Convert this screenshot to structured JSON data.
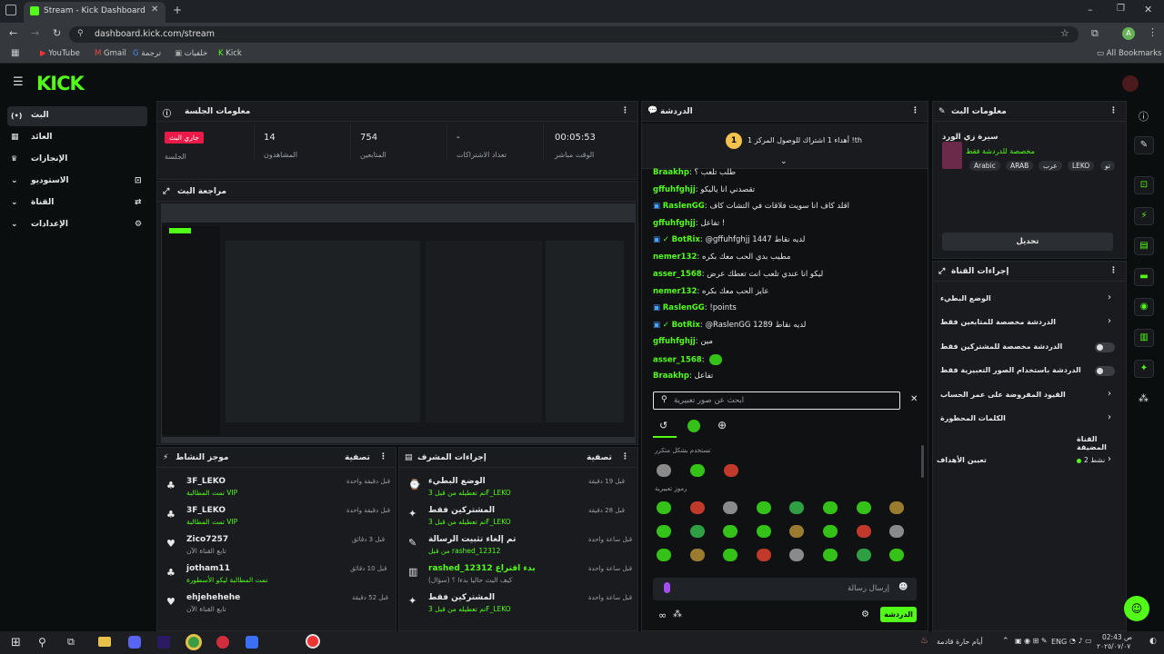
{
  "browser": {
    "tab_title": "Stream - Kick Dashboard",
    "url": "dashboard.kick.com/stream",
    "profile_initial": "A",
    "bookmarks": [
      "YouTube",
      "Gmail",
      "ترجمة",
      "خلفيات",
      "Kick"
    ],
    "all_bookmarks": "All Bookmarks"
  },
  "nav": {
    "items": [
      {
        "label": "البث",
        "icon": "(•)"
      },
      {
        "label": "العائد",
        "icon": "▦"
      },
      {
        "label": "الإنجازات",
        "icon": "🏆"
      },
      {
        "label": "الاستوديو",
        "icon": "⊡"
      },
      {
        "label": "القناة",
        "icon": "⇄"
      },
      {
        "label": "الإعدادات",
        "icon": "⚙"
      }
    ]
  },
  "session": {
    "title": "معلومات الجلسة",
    "live_badge": "جاري البث",
    "session_label": "الجلسة",
    "stats": [
      {
        "value": "14",
        "label": "المشاهدون"
      },
      {
        "value": "754",
        "label": "المتابعين"
      },
      {
        "value": "-",
        "label": "تعداد الاشتراكات"
      },
      {
        "value": "00:05:53",
        "label": "الوقت مباشر"
      }
    ]
  },
  "preview": {
    "title": "مراجعة البث"
  },
  "activity": {
    "title": "موجز النشاط",
    "filter": "تصفية",
    "rows": [
      {
        "name": "3F_LEKO",
        "sub": "تمت المطالبة VIP",
        "time": "قبل دقيقة واحدة"
      },
      {
        "name": "3F_LEKO",
        "sub": "تمت المطالبة VIP",
        "time": "قبل دقيقة واحدة"
      },
      {
        "name": "Zico7257",
        "sub": "تابع القناة الآن",
        "time": "قبل 3 دقائق"
      },
      {
        "name": "jotham11",
        "sub": "تمت المطالبة ليكو الأسطورة",
        "time": "قبل 10 دقائق"
      },
      {
        "name": "ehjehehehe",
        "sub": "تابع القناة الآن",
        "time": "قبل 52 دقيقة"
      }
    ]
  },
  "modactions": {
    "title": "إجراءات المشرف",
    "filter": "تصفية",
    "rows": [
      {
        "title": "الوضع البطيء",
        "sub": "تم تعطيله من قبل 3F_LEKO",
        "time": "قبل 19 دقيقة"
      },
      {
        "title": "المشتركين فقط",
        "sub": "تم تعطيله من قبل 3F_LEKO",
        "time": "قبل 28 دقيقة"
      },
      {
        "title": "تم إلغاء تثبيت الرسالة",
        "sub": "من قبل rashed_12312",
        "time": "قبل ساعة واحدة"
      },
      {
        "title": "rashed_12312 بدء اقتراع",
        "sub": "كيف البث حاليا بدءا ؟ (سؤال)",
        "time": "قبل ساعة واحدة"
      },
      {
        "title": "المشتركين فقط",
        "sub": "تم تعطيله من قبل 3F_LEKO",
        "time": "قبل ساعة واحدة"
      }
    ]
  },
  "chat": {
    "title": "الدردشة",
    "pinned": "أهداء 1 اشتراك للوصول المركز 1 !th",
    "messages": [
      {
        "name": "Braakhp",
        "text": "طلب تلعب ؟"
      },
      {
        "name": "gffuhfghjj",
        "text": "تقصدني انا ياليكو"
      },
      {
        "name": "RaslenGG",
        "text": "اقلد كاف انا سويت فلاقات في التشات كاف"
      },
      {
        "name": "gffuhfghjj",
        "text": "تفاعل !"
      },
      {
        "name": "BotRix",
        "text": "@gffuhfghjj 1447 لديه نقاط"
      },
      {
        "name": "nemer132",
        "text": "مطيب بدي الحب معك بكره"
      },
      {
        "name": "asser_1568",
        "text": "ليكو انا عندي تلعب انت تعطك عرض"
      },
      {
        "name": "nemer132",
        "text": "عايز الحب معك بكره"
      },
      {
        "name": "RaslenGG",
        "text": "!points"
      },
      {
        "name": "BotRix",
        "text": "@RaslenGG 1289 لديه نقاط"
      },
      {
        "name": "gffuhfghjj",
        "text": "مين"
      },
      {
        "name": "asser_1568",
        "text": ""
      },
      {
        "name": "Braakhp",
        "text": "تفاعل"
      }
    ],
    "emote_search_placeholder": "ابحث عن صور تعبيرية",
    "frequent_label": "تستخدم بشكل متكرر",
    "emotes_label": "رموز تعبيرية",
    "input_placeholder": "إرسال رسالة",
    "send_button": "الدردشة"
  },
  "streaminfo": {
    "title": "معلومات البث",
    "stream_title": "سيرة زي الورد",
    "category": "مخصصة للدردشة فقط",
    "tags": [
      "Arabic",
      "ARAB",
      "عرب",
      "LEKO",
      "تو"
    ],
    "edit_button": "تحديل"
  },
  "channelactions": {
    "title": "إجراءات القناة",
    "rows": [
      {
        "label": "الوضع البطيء",
        "control": "chevron"
      },
      {
        "label": "الدردشة مخصصة للمتابعين فقط",
        "control": "chevron"
      },
      {
        "label": "الدردشة مخصصة للمشتركين فقط",
        "control": "toggle"
      },
      {
        "label": "الدردشة باستخدام الصور التعبيرية فقط",
        "control": "toggle"
      },
      {
        "label": "القيود المفروضة على عمر الحساب",
        "control": "chevron"
      },
      {
        "label": "الكلمات المحظورة",
        "control": "chevron"
      }
    ],
    "featured": "القناة المضيفة",
    "goals_label": "تعيين الأهداف",
    "goals_value": "نشط 2"
  },
  "taskbar": {
    "time": "02:43 ص",
    "date": "٢٠٢٥/٠٧/٠٧",
    "lang": "ENG",
    "weather": "أيام حارة قادمة"
  }
}
